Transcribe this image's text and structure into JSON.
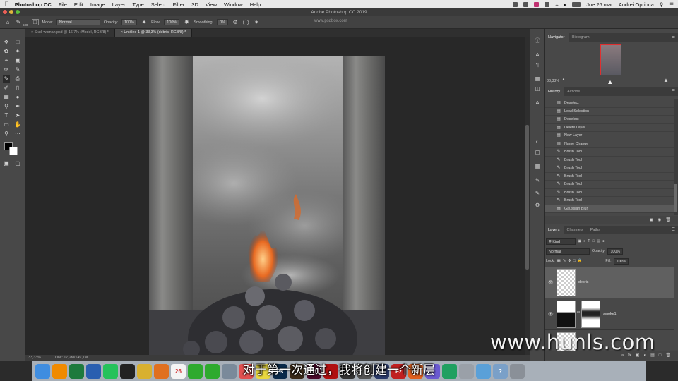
{
  "menubar": {
    "app_name": "Photoshop CC",
    "items": [
      "File",
      "Edit",
      "Image",
      "Layer",
      "Type",
      "Select",
      "Filter",
      "3D",
      "View",
      "Window",
      "Help"
    ],
    "datetime": "Jue 26 mar",
    "user": "Andrei Oprinca"
  },
  "window": {
    "title": "Adobe Photoshop CC 2019"
  },
  "options": {
    "brush_size": "600",
    "mode_label": "Mode:",
    "mode_value": "Normal",
    "opacity_label": "Opacity:",
    "opacity_value": "100%",
    "flow_label": "Flow:",
    "flow_value": "100%",
    "smoothing_label": "Smoothing:",
    "smoothing_value": "0%",
    "watermark": "www.psdbox.com"
  },
  "tabs": [
    {
      "label": "Skull woman.psd @ 16,7% (Model, RGB/8) *"
    },
    {
      "label": "Untitled-1 @ 33,3% (debris, RGB/8) *"
    }
  ],
  "status": {
    "zoom": "33,33%",
    "doc": "Doc: 17,2M/149,7M"
  },
  "navigator": {
    "tabs": [
      "Navigator",
      "Histogram"
    ],
    "zoom": "33,33%"
  },
  "history": {
    "tabs": [
      "History",
      "Actions"
    ],
    "items": [
      "Deselect",
      "Load Selection",
      "Deselect",
      "Delete Layer",
      "New Layer",
      "Name Change",
      "Brush Tool",
      "Brush Tool",
      "Brush Tool",
      "Brush Tool",
      "Brush Tool",
      "Brush Tool",
      "Brush Tool",
      "Gaussian Blur"
    ],
    "selected_index": 13
  },
  "layers": {
    "tabs": [
      "Layers",
      "Channels",
      "Paths"
    ],
    "kind": "Kind",
    "blend_mode": "Normal",
    "opacity_label": "Opacity:",
    "opacity_value": "100%",
    "lock_label": "Lock:",
    "fill_label": "Fill:",
    "fill_value": "100%",
    "items": [
      {
        "name": "debris",
        "selected": true
      },
      {
        "name": "smoke1",
        "selected": false
      },
      {
        "name": "",
        "selected": false
      }
    ]
  },
  "overlay": {
    "subtitle": "对于第一次通过，我将创建一个新层",
    "brand": "www.hunls.com"
  },
  "dock": {
    "apps": [
      {
        "icon": "finder-icon",
        "color": "#3f8de0"
      },
      {
        "icon": "vlc-icon",
        "color": "#f08a00"
      },
      {
        "icon": "excel-icon",
        "color": "#1d7a3d"
      },
      {
        "icon": "word-icon",
        "color": "#2a5fb0"
      },
      {
        "icon": "whatsapp-icon",
        "color": "#25c25b"
      },
      {
        "icon": "activity-monitor-icon",
        "color": "#222"
      },
      {
        "icon": "notes-icon",
        "color": "#d8b030"
      },
      {
        "icon": "books-icon",
        "color": "#e07020"
      },
      {
        "icon": "calendar-icon",
        "color": "#f4f4f4",
        "text": "26"
      },
      {
        "icon": "camtasia-icon",
        "color": "#2eaa2e"
      },
      {
        "icon": "camtasia2-icon",
        "color": "#2eaa2e"
      },
      {
        "icon": "preview-icon",
        "color": "#7a8a9a"
      },
      {
        "icon": "photos-icon",
        "color": "#e05050"
      },
      {
        "icon": "stickies-icon",
        "color": "#e8d840"
      },
      {
        "icon": "photoshop-icon",
        "color": "#0a2a4a",
        "text": "Ps"
      },
      {
        "icon": "bridge-icon",
        "color": "#3a2a1a"
      },
      {
        "icon": "indesign-icon",
        "color": "#4a0a2a",
        "text": "Id"
      },
      {
        "icon": "acrobat-icon",
        "color": "#b01010"
      },
      {
        "icon": "clapper-icon",
        "color": "#333"
      },
      {
        "icon": "dvd-icon",
        "color": "#555"
      },
      {
        "icon": "cinema4d-icon",
        "color": "#2a3a6a"
      },
      {
        "icon": "filezilla-icon",
        "color": "#c02020",
        "text": "Fz"
      },
      {
        "icon": "firefox-icon",
        "color": "#e06020"
      },
      {
        "icon": "chrome-icon",
        "color": "#6a5ad0"
      },
      {
        "icon": "fingerprint-icon",
        "color": "#20a060"
      },
      {
        "icon": "music-icon",
        "color": "#9aa0a8"
      },
      {
        "icon": "folder-icon",
        "color": "#5aa0d8"
      },
      {
        "icon": "help-icon",
        "color": "#7aa0c8",
        "text": "?"
      },
      {
        "icon": "trash-icon",
        "color": "#8a9098"
      }
    ]
  }
}
